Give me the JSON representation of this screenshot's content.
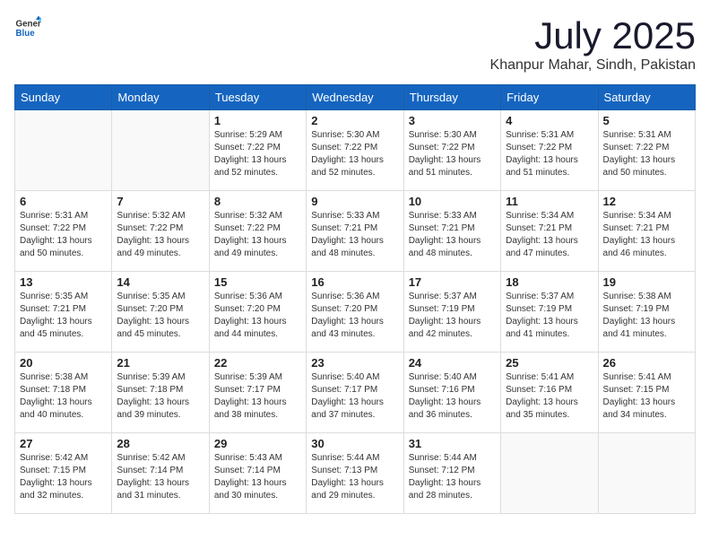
{
  "header": {
    "logo_general": "General",
    "logo_blue": "Blue",
    "month": "July 2025",
    "location": "Khanpur Mahar, Sindh, Pakistan"
  },
  "weekdays": [
    "Sunday",
    "Monday",
    "Tuesday",
    "Wednesday",
    "Thursday",
    "Friday",
    "Saturday"
  ],
  "weeks": [
    [
      {
        "day": "",
        "info": ""
      },
      {
        "day": "",
        "info": ""
      },
      {
        "day": "1",
        "info": "Sunrise: 5:29 AM\nSunset: 7:22 PM\nDaylight: 13 hours and 52 minutes."
      },
      {
        "day": "2",
        "info": "Sunrise: 5:30 AM\nSunset: 7:22 PM\nDaylight: 13 hours and 52 minutes."
      },
      {
        "day": "3",
        "info": "Sunrise: 5:30 AM\nSunset: 7:22 PM\nDaylight: 13 hours and 51 minutes."
      },
      {
        "day": "4",
        "info": "Sunrise: 5:31 AM\nSunset: 7:22 PM\nDaylight: 13 hours and 51 minutes."
      },
      {
        "day": "5",
        "info": "Sunrise: 5:31 AM\nSunset: 7:22 PM\nDaylight: 13 hours and 50 minutes."
      }
    ],
    [
      {
        "day": "6",
        "info": "Sunrise: 5:31 AM\nSunset: 7:22 PM\nDaylight: 13 hours and 50 minutes."
      },
      {
        "day": "7",
        "info": "Sunrise: 5:32 AM\nSunset: 7:22 PM\nDaylight: 13 hours and 49 minutes."
      },
      {
        "day": "8",
        "info": "Sunrise: 5:32 AM\nSunset: 7:22 PM\nDaylight: 13 hours and 49 minutes."
      },
      {
        "day": "9",
        "info": "Sunrise: 5:33 AM\nSunset: 7:21 PM\nDaylight: 13 hours and 48 minutes."
      },
      {
        "day": "10",
        "info": "Sunrise: 5:33 AM\nSunset: 7:21 PM\nDaylight: 13 hours and 48 minutes."
      },
      {
        "day": "11",
        "info": "Sunrise: 5:34 AM\nSunset: 7:21 PM\nDaylight: 13 hours and 47 minutes."
      },
      {
        "day": "12",
        "info": "Sunrise: 5:34 AM\nSunset: 7:21 PM\nDaylight: 13 hours and 46 minutes."
      }
    ],
    [
      {
        "day": "13",
        "info": "Sunrise: 5:35 AM\nSunset: 7:21 PM\nDaylight: 13 hours and 45 minutes."
      },
      {
        "day": "14",
        "info": "Sunrise: 5:35 AM\nSunset: 7:20 PM\nDaylight: 13 hours and 45 minutes."
      },
      {
        "day": "15",
        "info": "Sunrise: 5:36 AM\nSunset: 7:20 PM\nDaylight: 13 hours and 44 minutes."
      },
      {
        "day": "16",
        "info": "Sunrise: 5:36 AM\nSunset: 7:20 PM\nDaylight: 13 hours and 43 minutes."
      },
      {
        "day": "17",
        "info": "Sunrise: 5:37 AM\nSunset: 7:19 PM\nDaylight: 13 hours and 42 minutes."
      },
      {
        "day": "18",
        "info": "Sunrise: 5:37 AM\nSunset: 7:19 PM\nDaylight: 13 hours and 41 minutes."
      },
      {
        "day": "19",
        "info": "Sunrise: 5:38 AM\nSunset: 7:19 PM\nDaylight: 13 hours and 41 minutes."
      }
    ],
    [
      {
        "day": "20",
        "info": "Sunrise: 5:38 AM\nSunset: 7:18 PM\nDaylight: 13 hours and 40 minutes."
      },
      {
        "day": "21",
        "info": "Sunrise: 5:39 AM\nSunset: 7:18 PM\nDaylight: 13 hours and 39 minutes."
      },
      {
        "day": "22",
        "info": "Sunrise: 5:39 AM\nSunset: 7:17 PM\nDaylight: 13 hours and 38 minutes."
      },
      {
        "day": "23",
        "info": "Sunrise: 5:40 AM\nSunset: 7:17 PM\nDaylight: 13 hours and 37 minutes."
      },
      {
        "day": "24",
        "info": "Sunrise: 5:40 AM\nSunset: 7:16 PM\nDaylight: 13 hours and 36 minutes."
      },
      {
        "day": "25",
        "info": "Sunrise: 5:41 AM\nSunset: 7:16 PM\nDaylight: 13 hours and 35 minutes."
      },
      {
        "day": "26",
        "info": "Sunrise: 5:41 AM\nSunset: 7:15 PM\nDaylight: 13 hours and 34 minutes."
      }
    ],
    [
      {
        "day": "27",
        "info": "Sunrise: 5:42 AM\nSunset: 7:15 PM\nDaylight: 13 hours and 32 minutes."
      },
      {
        "day": "28",
        "info": "Sunrise: 5:42 AM\nSunset: 7:14 PM\nDaylight: 13 hours and 31 minutes."
      },
      {
        "day": "29",
        "info": "Sunrise: 5:43 AM\nSunset: 7:14 PM\nDaylight: 13 hours and 30 minutes."
      },
      {
        "day": "30",
        "info": "Sunrise: 5:44 AM\nSunset: 7:13 PM\nDaylight: 13 hours and 29 minutes."
      },
      {
        "day": "31",
        "info": "Sunrise: 5:44 AM\nSunset: 7:12 PM\nDaylight: 13 hours and 28 minutes."
      },
      {
        "day": "",
        "info": ""
      },
      {
        "day": "",
        "info": ""
      }
    ]
  ]
}
